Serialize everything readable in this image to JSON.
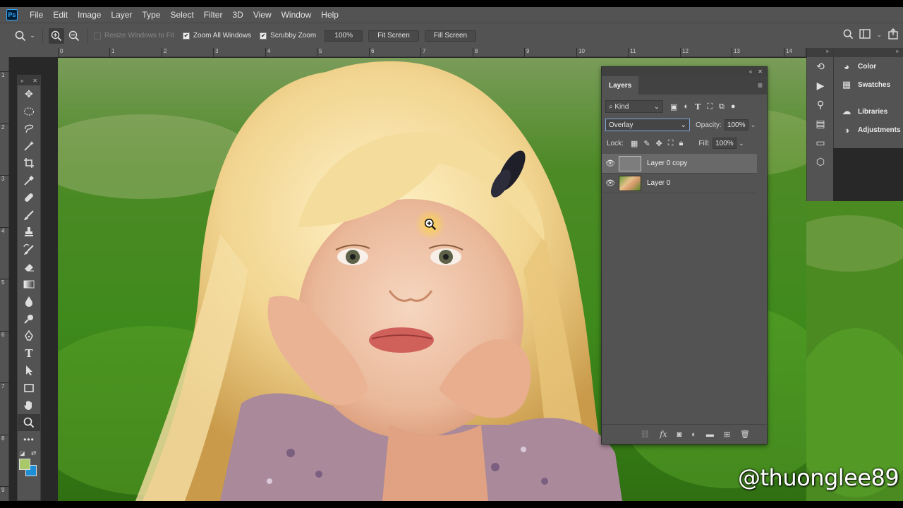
{
  "app": {
    "logo_text": "Ps"
  },
  "menu": [
    "File",
    "Edit",
    "Image",
    "Layer",
    "Type",
    "Select",
    "Filter",
    "3D",
    "View",
    "Window",
    "Help"
  ],
  "options": {
    "resize_windows": "Resize Windows to Fit",
    "zoom_all": "Zoom All Windows",
    "scrubby_zoom": "Scrubby Zoom",
    "zoom_value": "100%",
    "fit_screen": "Fit Screen",
    "fill_screen": "Fill Screen"
  },
  "ruler": {
    "h_ticks": [
      "0",
      "1",
      "2",
      "3",
      "4",
      "5",
      "6",
      "7",
      "8",
      "9",
      "10",
      "11",
      "12",
      "13",
      "14"
    ],
    "v_ticks": [
      "1",
      "2",
      "3",
      "4",
      "5",
      "6",
      "7",
      "8",
      "9"
    ]
  },
  "layers_panel": {
    "tab": "Layers",
    "kind": "Kind",
    "blend_mode": "Overlay",
    "opacity_label": "Opacity:",
    "opacity": "100%",
    "lock_label": "Lock:",
    "fill_label": "Fill:",
    "fill": "100%",
    "layers": [
      {
        "name": "Layer 0 copy",
        "selected": true,
        "thumb": "gray"
      },
      {
        "name": "Layer 0",
        "selected": false,
        "thumb": "photo"
      }
    ]
  },
  "dock": {
    "items": [
      {
        "label": "Color",
        "icon": "color-icon"
      },
      {
        "label": "Swatches",
        "icon": "swatches-icon"
      },
      {
        "label": "Libraries",
        "icon": "libraries-icon"
      },
      {
        "label": "Adjustments",
        "icon": "adjustments-icon"
      }
    ]
  },
  "colors": {
    "foreground": "#a8c86a",
    "background": "#1e8fd6",
    "panel": "#535353",
    "accent": "#31a8ff"
  },
  "watermark": "@thuonglee89"
}
